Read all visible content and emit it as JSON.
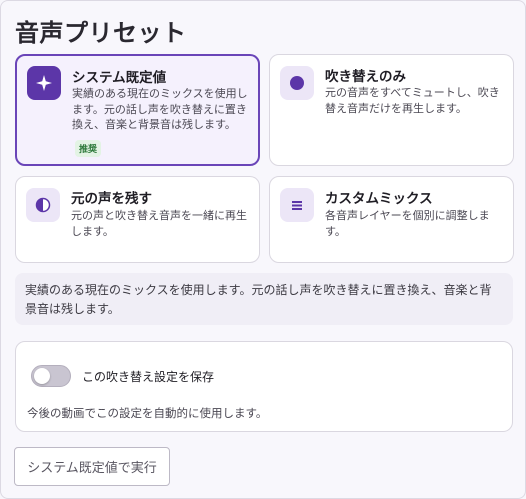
{
  "page": {
    "title": "音声プリセット"
  },
  "presets": [
    {
      "title": "システム既定値",
      "description": "実績のある現在のミックスを使用します。元の話し声を吹き替えに置き換え、音楽と背景音は残します。",
      "badge": "推奨",
      "icon": "sparkle-icon",
      "selected": true
    },
    {
      "title": "吹き替えのみ",
      "description": "元の音声をすべてミュートし、吹き替え音声だけを再生します。",
      "icon": "filled-circle-icon",
      "selected": false
    },
    {
      "title": "元の声を残す",
      "description": "元の声と吹き替え音声を一緒に再生します。",
      "icon": "half-circle-icon",
      "selected": false
    },
    {
      "title": "カスタムミックス",
      "description": "各音声レイヤーを個別に調整します。",
      "icon": "equalizer-icon",
      "selected": false
    }
  ],
  "info": {
    "text": "実績のある現在のミックスを使用します。元の話し声を吹き替えに置き換え、音楽と背景音は残します。"
  },
  "save_setting": {
    "label": "この吹き替え設定を保存",
    "description": "今後の動画でこの設定を自動的に使用します。",
    "enabled": false
  },
  "run_button": {
    "label": "システム既定値で実行"
  },
  "colors": {
    "accent": "#5c36a8",
    "selected_border": "#6a45b8",
    "badge_green": "#2f7a3c"
  }
}
